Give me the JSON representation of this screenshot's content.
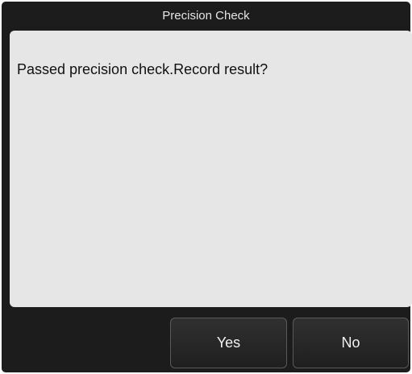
{
  "dialog": {
    "title": "Precision Check",
    "message": "Passed precision check.Record result?",
    "buttons": {
      "yes_label": "Yes",
      "no_label": "No"
    }
  },
  "colors": {
    "frame": "#1c1c1c",
    "content_background": "#e6e6e6",
    "button_background": "#2a2a2a",
    "button_border": "#5a5a5a"
  }
}
